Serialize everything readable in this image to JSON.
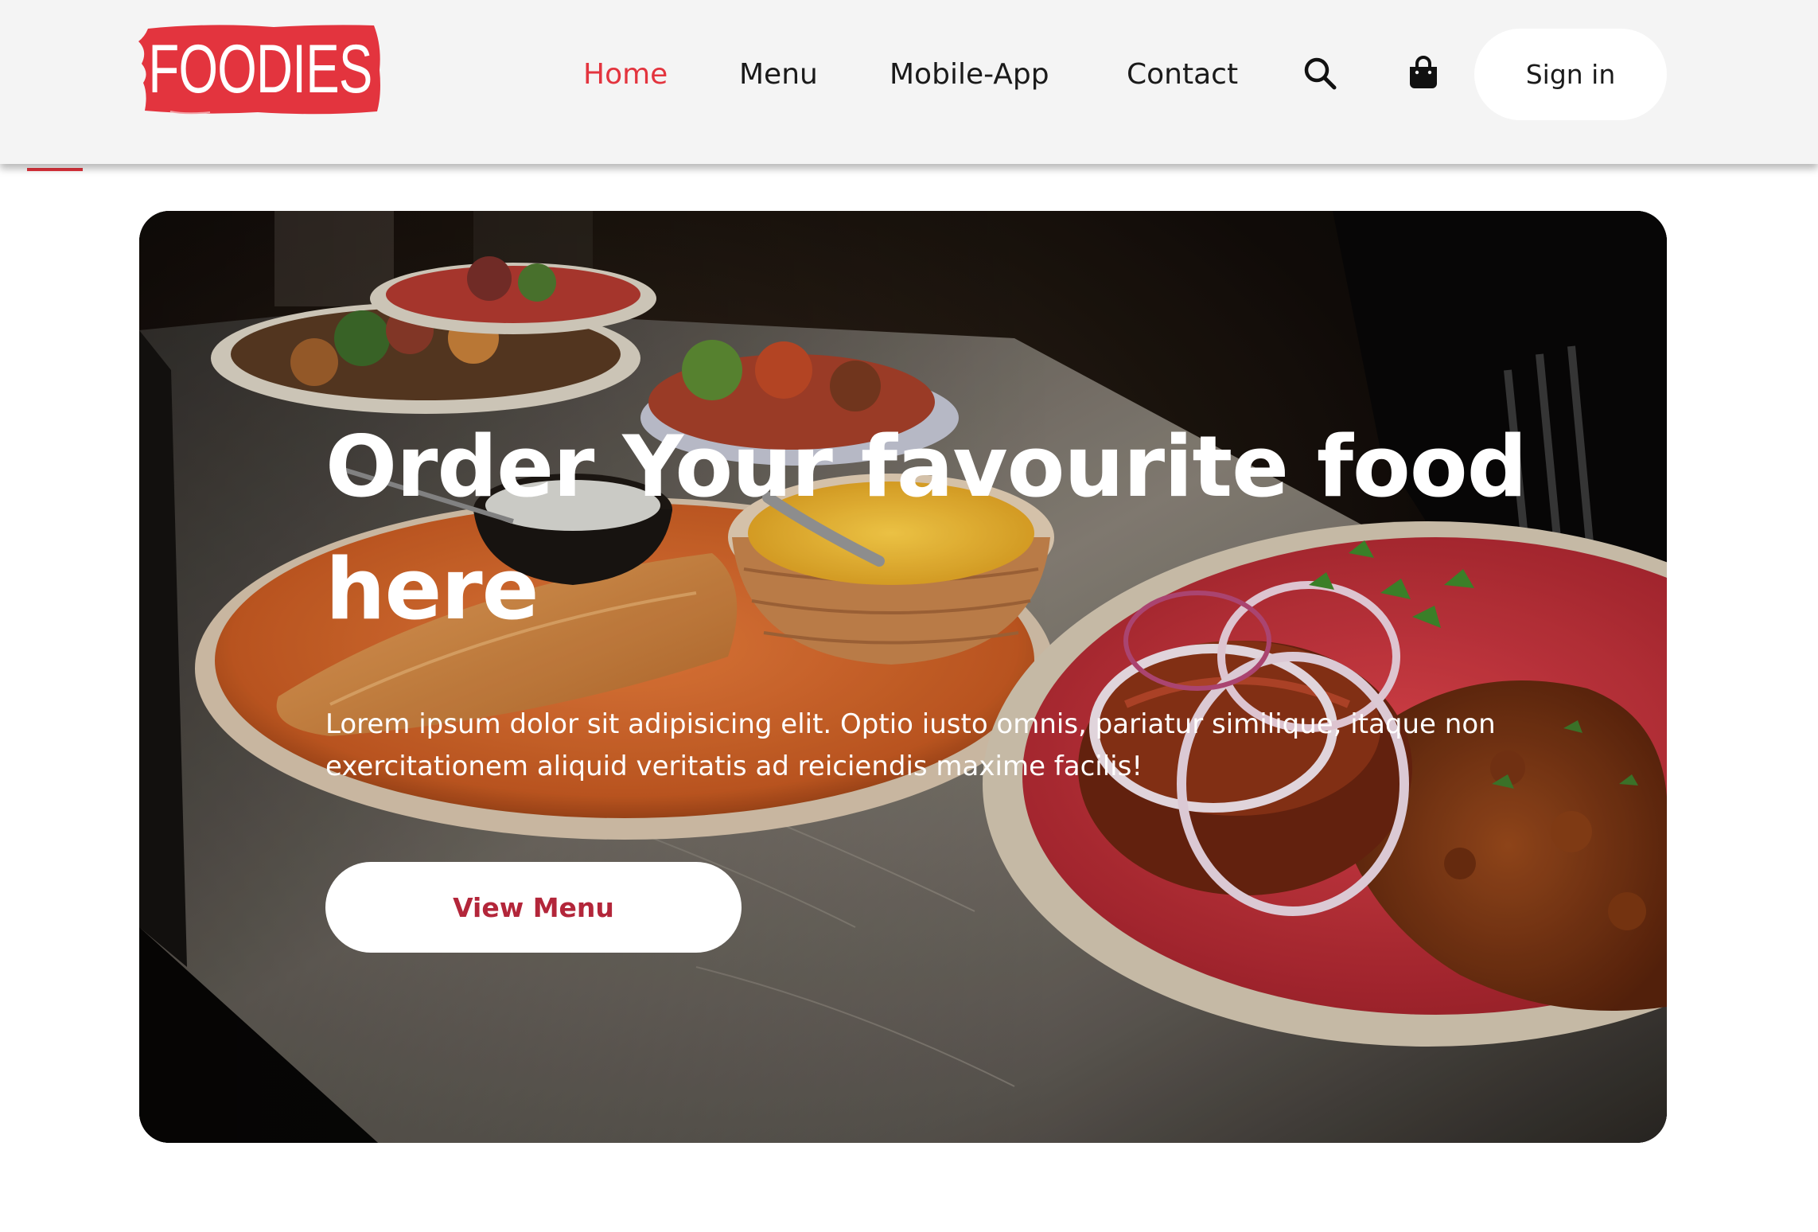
{
  "brand": {
    "logo_text": "FOODIES",
    "accent_color": "#e3343e"
  },
  "nav": {
    "items": [
      {
        "label": "Home",
        "active": true
      },
      {
        "label": "Menu",
        "active": false
      },
      {
        "label": "Mobile-App",
        "active": false
      },
      {
        "label": "Contact",
        "active": false
      }
    ],
    "icons": [
      "search-icon",
      "shopping-bag-icon"
    ],
    "signin_label": "Sign in"
  },
  "hero": {
    "title": "Order Your favourite food here",
    "description": "Lorem ipsum dolor sit adipisicing elit. Optio iusto omnis, pariatur similique, itaque non exercitationem aliquid veritatis ad reiciendis maxime facilis!",
    "cta_label": "View Menu",
    "cta_text_color": "#b3263a"
  }
}
